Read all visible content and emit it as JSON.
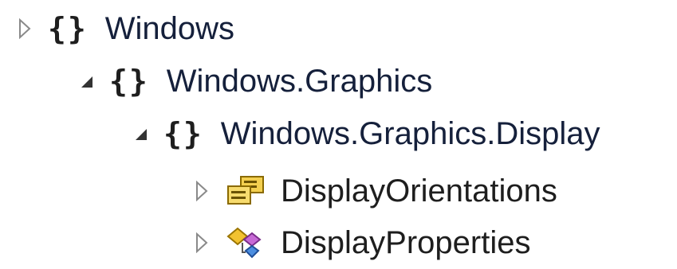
{
  "tree": {
    "nodes": [
      {
        "label": "Windows",
        "icon": "namespace-icon",
        "icon_glyph": "{}",
        "expander": "collapsed"
      },
      {
        "label": "Windows.Graphics",
        "icon": "namespace-icon",
        "icon_glyph": "{}",
        "expander": "expanded"
      },
      {
        "label": "Windows.Graphics.Display",
        "icon": "namespace-icon",
        "icon_glyph": "{}",
        "expander": "expanded"
      },
      {
        "label": "DisplayOrientations",
        "icon": "enum-icon",
        "expander": "collapsed"
      },
      {
        "label": "DisplayProperties",
        "icon": "class-icon",
        "expander": "collapsed"
      }
    ]
  },
  "colors": {
    "background": "#ffffff",
    "text": "#1f1f1f",
    "enum_icon": "#d8a200",
    "class_icon_gold": "#e5b320",
    "class_icon_purple": "#b85cc9",
    "class_icon_blue": "#3a7bd5"
  }
}
